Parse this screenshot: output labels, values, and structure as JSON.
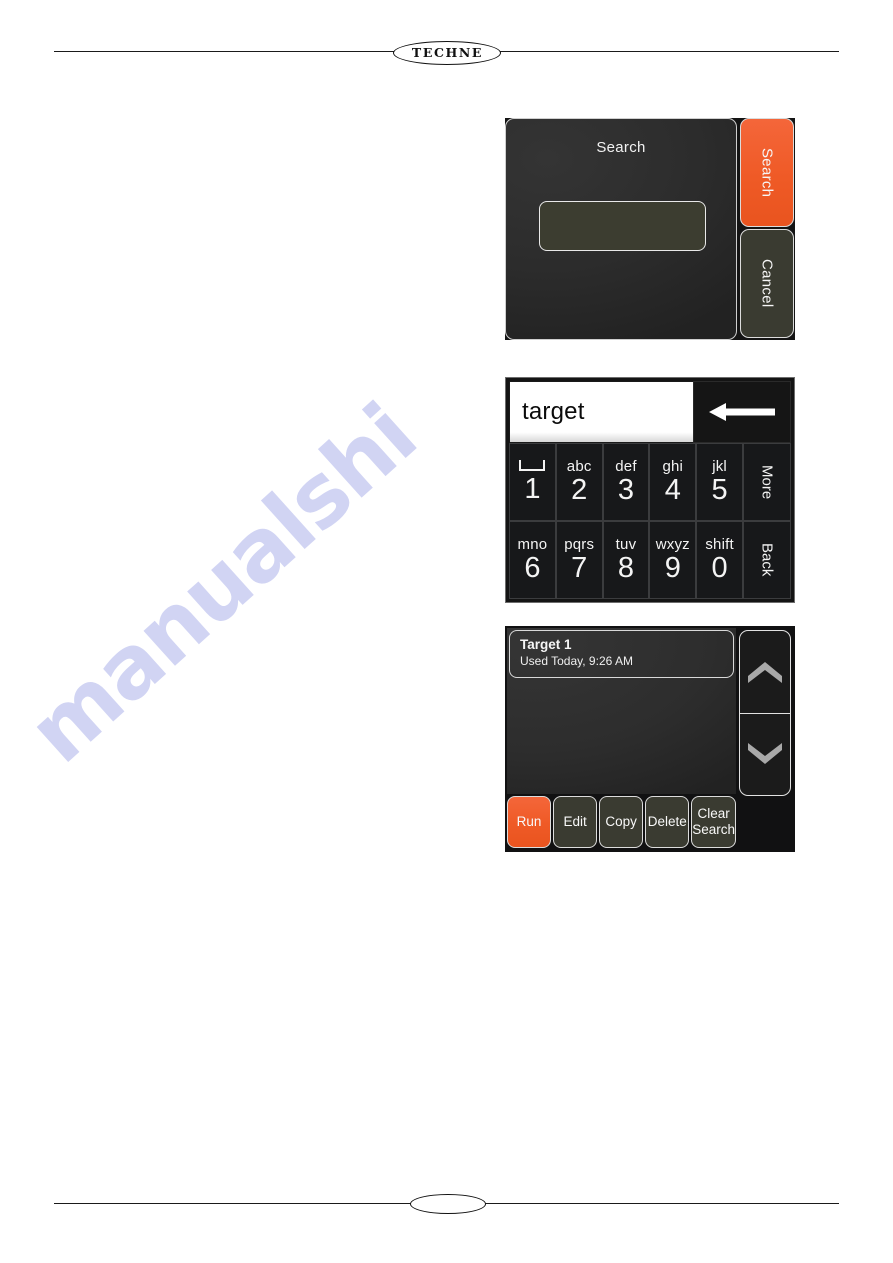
{
  "page": {
    "logo_text": "TECHNE",
    "watermark_text": "manualshi"
  },
  "search_screen": {
    "title": "Search",
    "input_value": "",
    "input_placeholder": "",
    "buttons": [
      {
        "label": "Search",
        "style": "accent"
      },
      {
        "label": "Cancel",
        "style": "olive"
      }
    ]
  },
  "keypad_screen": {
    "text_value": "target",
    "backspace_icon": "backspace-arrow-icon",
    "keys": [
      [
        {
          "letters": "",
          "digit": "1",
          "glyph": "spacebar"
        },
        {
          "letters": "abc",
          "digit": "2",
          "glyph": ""
        },
        {
          "letters": "def",
          "digit": "3",
          "glyph": ""
        },
        {
          "letters": "ghi",
          "digit": "4",
          "glyph": ""
        },
        {
          "letters": "jkl",
          "digit": "5",
          "glyph": ""
        }
      ],
      [
        {
          "letters": "mno",
          "digit": "6",
          "glyph": ""
        },
        {
          "letters": "pqrs",
          "digit": "7",
          "glyph": ""
        },
        {
          "letters": "tuv",
          "digit": "8",
          "glyph": ""
        },
        {
          "letters": "wxyz",
          "digit": "9",
          "glyph": ""
        },
        {
          "letters": "shift",
          "digit": "0",
          "glyph": ""
        }
      ]
    ],
    "side_buttons": [
      {
        "label": "More"
      },
      {
        "label": "Back"
      }
    ]
  },
  "results_screen": {
    "items": [
      {
        "title": "Target 1",
        "subtitle": "Used Today, 9:26 AM"
      }
    ],
    "scroll": [
      {
        "icon": "chevron-up-icon"
      },
      {
        "icon": "chevron-down-icon"
      }
    ],
    "buttons": [
      {
        "label": "Run",
        "style": "accent"
      },
      {
        "label": "Edit",
        "style": "olive"
      },
      {
        "label": "Copy",
        "style": "olive"
      },
      {
        "label": "Delete",
        "style": "olive"
      },
      {
        "label": "Clear Search",
        "style": "olive"
      }
    ]
  }
}
